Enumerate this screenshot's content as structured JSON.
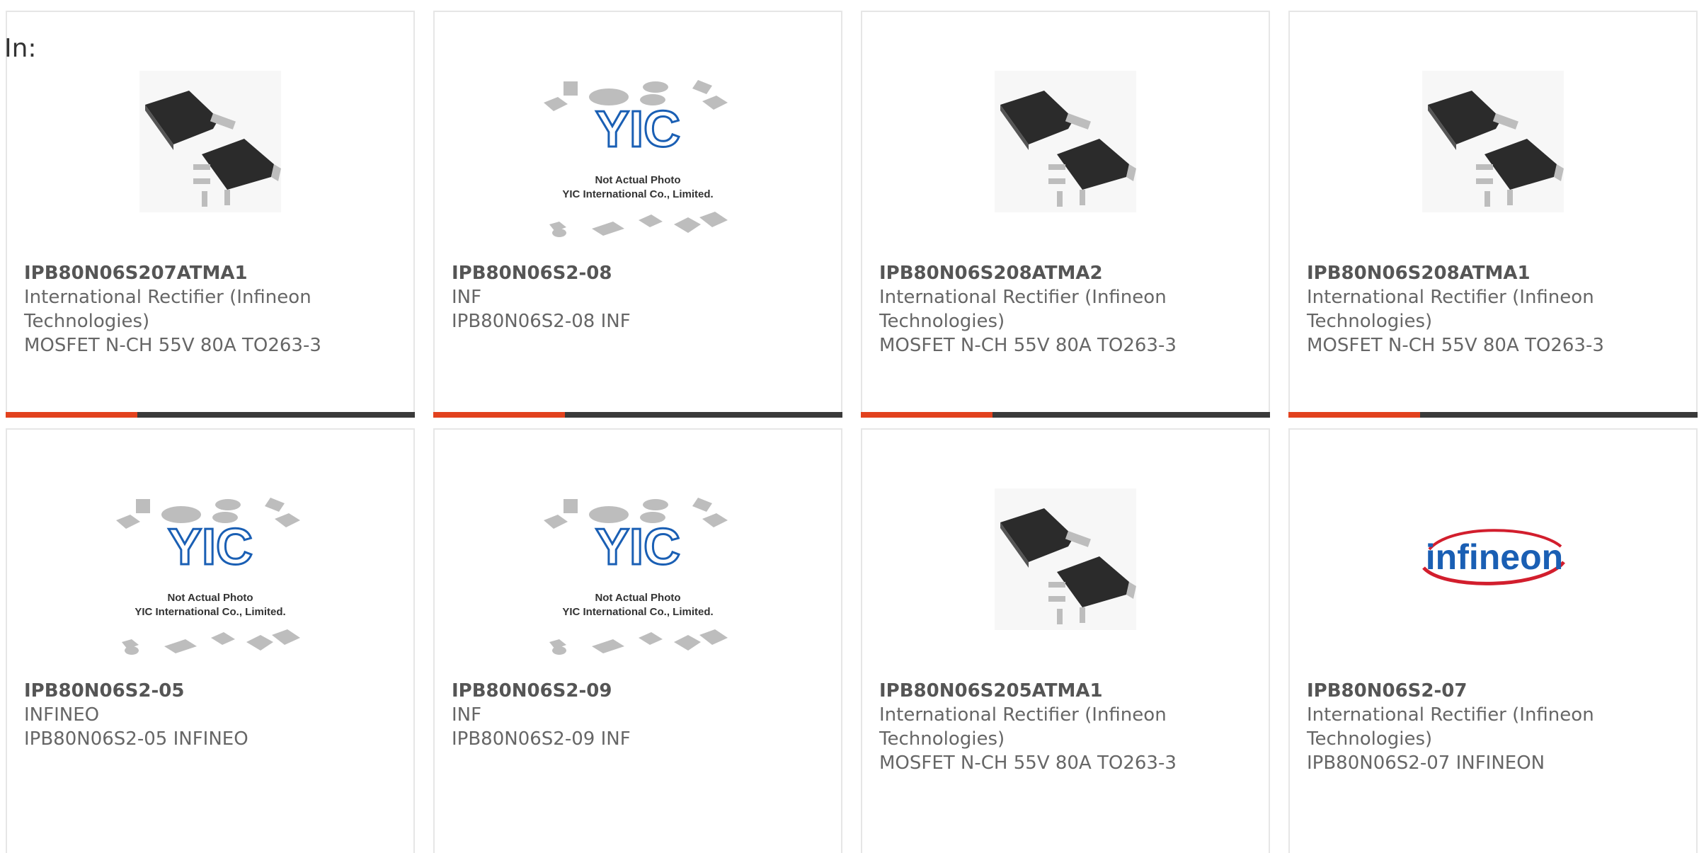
{
  "page": {
    "filter_label": "In:"
  },
  "colors": {
    "accent": "#e2421e",
    "bar_dark": "#3a3a3a",
    "brand_blue": "#1a5fb4",
    "infineon_red": "#d21e2d"
  },
  "cards": [
    {
      "part": "IPB80N06S207ATMA1",
      "mfr_line1": "International Rectifier (Infineon",
      "mfr_line2": "Technologies)",
      "desc": "MOSFET N-CH 55V 80A TO263-3",
      "image": "mosfet-to263-photo"
    },
    {
      "part": "IPB80N06S2-08",
      "mfr_line1": "INF",
      "mfr_line2": "",
      "desc": "IPB80N06S2-08 INF",
      "image": "yic-placeholder",
      "image_text": {
        "brand": "YIC",
        "note1": "Not Actual Photo",
        "note2": "YIC International Co., Limited."
      }
    },
    {
      "part": "IPB80N06S208ATMA2",
      "mfr_line1": "International Rectifier (Infineon",
      "mfr_line2": "Technologies)",
      "desc": "MOSFET N-CH 55V 80A TO263-3",
      "image": "mosfet-to263-photo"
    },
    {
      "part": "IPB80N06S208ATMA1",
      "mfr_line1": "International Rectifier (Infineon",
      "mfr_line2": "Technologies)",
      "desc": "MOSFET N-CH 55V 80A TO263-3",
      "image": "mosfet-to263-photo"
    },
    {
      "part": "IPB80N06S2-05",
      "mfr_line1": "INFINEO",
      "mfr_line2": "",
      "desc": "IPB80N06S2-05 INFINEO",
      "image": "yic-placeholder",
      "image_text": {
        "brand": "YIC",
        "note1": "Not Actual Photo",
        "note2": "YIC International Co., Limited."
      }
    },
    {
      "part": "IPB80N06S2-09",
      "mfr_line1": "INF",
      "mfr_line2": "",
      "desc": "IPB80N06S2-09 INF",
      "image": "yic-placeholder",
      "image_text": {
        "brand": "YIC",
        "note1": "Not Actual Photo",
        "note2": "YIC International Co., Limited."
      }
    },
    {
      "part": "IPB80N06S205ATMA1",
      "mfr_line1": "International Rectifier (Infineon",
      "mfr_line2": "Technologies)",
      "desc": "MOSFET N-CH 55V 80A TO263-3",
      "image": "mosfet-to263-photo"
    },
    {
      "part": "IPB80N06S2-07",
      "mfr_line1": "International Rectifier (Infineon",
      "mfr_line2": "Technologies)",
      "desc": "IPB80N06S2-07 INFINEON",
      "image": "infineon-logo",
      "image_text": {
        "brand": "infineon"
      }
    }
  ]
}
